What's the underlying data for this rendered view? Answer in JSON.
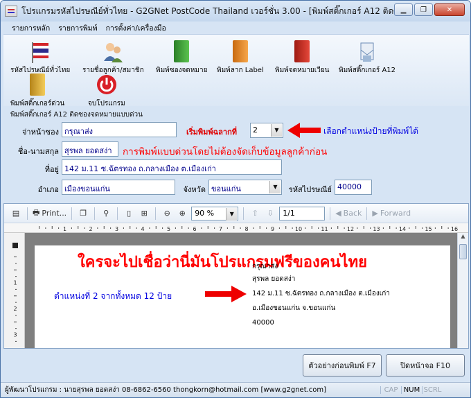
{
  "window": {
    "title": "โปรแกรมรหัสไปรษณีย์ทั่วไทย - G2GNet PostCode Thailand เวอร์ชั่น 3.00 - [พิมพ์สติ๊กเกอร์ A12 ติดซองจ..."
  },
  "menu": {
    "items": [
      "รายการหลัก",
      "รายการพิมพ์",
      "การตั้งค่า/เครื่องมือ"
    ]
  },
  "toolbar": {
    "items": [
      {
        "label": "รหัสไปรษณีย์ทั่วไทย",
        "icon": "thai-flag-icon"
      },
      {
        "label": "รายชื่อลูกค้า/สมาชิก",
        "icon": "users-icon"
      },
      {
        "label": "พิมพ์ซองจดหมาย",
        "icon": "green-folder-icon",
        "color": "#3aa535"
      },
      {
        "label": "พิมพ์ลาก Label",
        "icon": "orange-folder-icon",
        "color": "#f08a1c"
      },
      {
        "label": "พิมพ์จดหมายเวียน",
        "icon": "red-folder-icon",
        "color": "#d62d20"
      },
      {
        "label": "พิมพ์สติ๊กเกอร์ A12",
        "icon": "sticker-icon"
      },
      {
        "label": "พิมพ์สติ๊กเกอร์ด่วน",
        "icon": "yellow-folder-icon",
        "color": "#e7b52c"
      },
      {
        "label": "จบโปรแกรม",
        "icon": "power-icon",
        "color": "#d91f26"
      }
    ]
  },
  "form": {
    "group_title": "พิมพ์สติ๊กเกอร์ A12 ติดซองจดหมายแบบด่วน",
    "fields": {
      "heading_label": "จ่าหน้าซอง",
      "heading_value": "กรุณาส่ง",
      "name_label": "ชื่อ-นามสกุล",
      "name_value": "สุรพล ยอดสง่า",
      "address_label": "ที่อยู่",
      "address_value": "142 ม.11 ซ.ฉัตรทอง ถ.กลางเมือง ต.เมืองเก่า",
      "district_label": "อำเภอ",
      "district_value": "เมืองขอนแก่น",
      "province_label": "จังหวัด",
      "province_value": "ขอนแก่น",
      "postcode_label": "รหัสไปรษณีย์",
      "postcode_value": "40000",
      "start_label": "เริ่มพิมพ์ฉลากที่",
      "start_value": "2"
    },
    "notes": {
      "position_note": "เลือกตำแหน่งป้ายที่พิมพ์ได้",
      "quick_print_note": "การพิมพ์แบบด่วนโดยไม่ต้องจัดเก็บข้อมูลลูกค้าก่อน"
    },
    "accent_red": "#e00000",
    "accent_blue": "#0000e0"
  },
  "viewer": {
    "print_label": "Print...",
    "zoom": "90 %",
    "page": "1/1",
    "back_label": "Back",
    "forward_label": "Forward",
    "ruler_numbers": [
      "1",
      "2",
      "3",
      "4",
      "5",
      "6",
      "7",
      "8",
      "9",
      "10",
      "11",
      "12",
      "13",
      "14",
      "15",
      "16"
    ],
    "vruler_numbers": [
      "1",
      "2",
      "3"
    ],
    "headline": "ใครจะไปเชื่อว่านี่มันโปรแกรมฟรีของคนไทย",
    "position_caption": "ตำแหน่งที่ 2 จากทั้งหมด 12 ป้าย",
    "label_lines": [
      "กรุณาส่ง",
      "สุรพล ยอดสง่า",
      "142 ม.11 ซ.ฉัตรทอง ถ.กลางเมือง ต.เมืองเก่า",
      "อ.เมืองขอนแก่น   จ.ขอนแก่น",
      "40000"
    ]
  },
  "buttons": {
    "preview": "ตัวอย่างก่อนพิมพ์ F7",
    "close": "ปิดหน้าจอ F10"
  },
  "status": {
    "text": "ผู้พัฒนาโปรแกรม : นายสุรพล ยอดสง่า 08-6862-6560 thongkorn@hotmail.com [www.g2gnet.com]",
    "keys": [
      "CAP",
      "NUM",
      "SCRL"
    ]
  }
}
